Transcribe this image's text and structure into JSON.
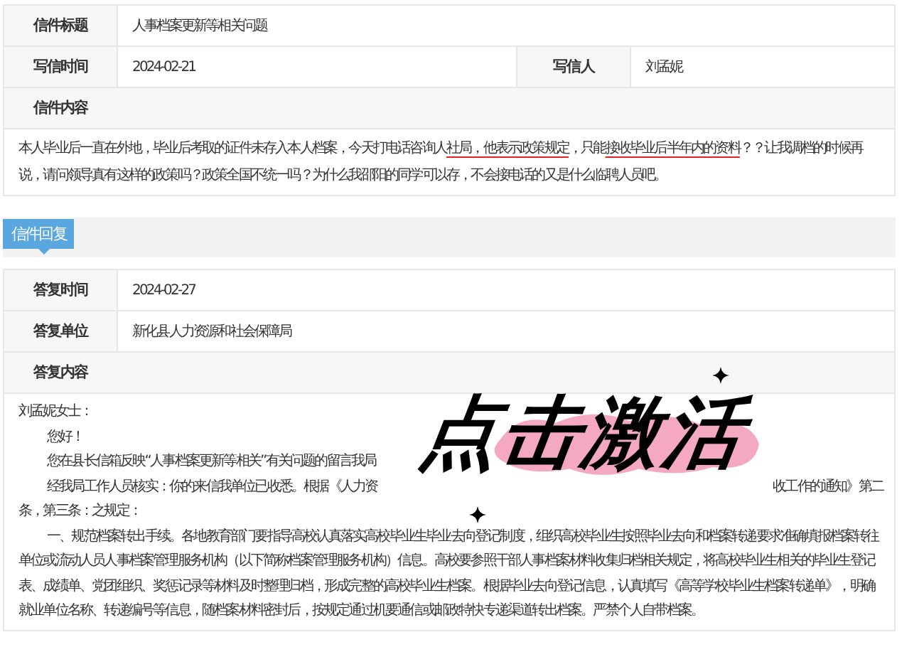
{
  "letter": {
    "title_label": "信件标题",
    "title": "人事档案更新等相关问题",
    "date_label": "写信时间",
    "date": "2024-02-21",
    "author_label": "写信人",
    "author": "刘孟妮",
    "content_label": "信件内容",
    "content": [
      {
        "text": "本人毕业后一直在外地，毕业后考取的证件未存入本人档案，今天打电话咨询人",
        "underlined": false
      },
      {
        "text": "社局，他表示政策规定",
        "underlined": true
      },
      {
        "text": "，只能",
        "underlined": false
      },
      {
        "text": "接收毕业后半年内的资料",
        "underlined": true
      },
      {
        "text": "？？让我调档的时候再说，请问领导真有这样的政策吗？政策全国不统一吗？为什么我邵阳的同学可以存，不会接电话的又是什么临聘人员吧。",
        "underlined": false
      }
    ]
  },
  "section_tab": {
    "label": "信件回复"
  },
  "reply": {
    "date_label": "答复时间",
    "date": "2024-02-27",
    "unit_label": "答复单位",
    "unit": "新化县人力资源和社会保障局",
    "content_label": "答复内容",
    "paragraphs": [
      {
        "kind": "salutation",
        "text": "刘孟妮女士："
      },
      {
        "kind": "paragraph",
        "text": "您好！"
      },
      {
        "kind": "covered",
        "start": "您在县长信箱反映“人事档案更新等相关”有关问题的留言我局"
      },
      {
        "kind": "covered",
        "start": "经我局工作人员核实：你的来信我单位已收悉。根据《人力资",
        "end": "收工作的通知》第二"
      },
      {
        "kind": "salutation",
        "text": "条，第三条：之规定："
      },
      {
        "kind": "paragraph",
        "text": "一、规范档案转出手续。各地教育部门要指导高校认真落实高校毕业生毕业去向登记制度，组织高校毕业生按照毕业去向和档案转递要求准确填报档案转往单位或流动人员人事档案管理服务机构（以下简称档案管理服务机构）信息。高校要参照干部人事档案材料收集归档相关规定，将高校毕业生相关的毕业生登记表、成绩单、党团组织、奖惩记录等材料及时整理归档，形成完整的高校毕业生档案。根据毕业去向登记信息，认真填写《高等学校毕业生档案转递单》，明确就业单位名称、转递编号等信息，随档案材料密封后，按规定通过机要通信或邮政特快专递渠道转出档案。严禁个人自带档案。"
      }
    ]
  },
  "overlay": {
    "text": "点击激活"
  }
}
